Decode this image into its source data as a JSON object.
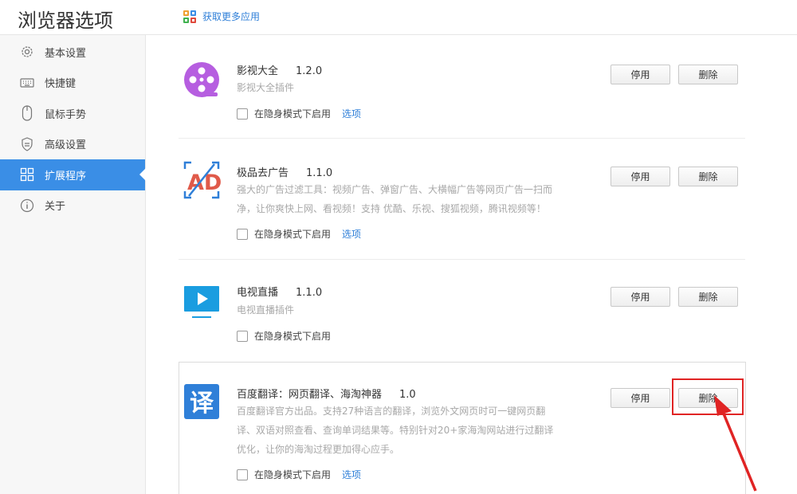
{
  "app": {
    "title": "浏览器选项"
  },
  "header": {
    "get_apps_label": "获取更多应用"
  },
  "sidebar": {
    "items": [
      {
        "label": "基本设置",
        "icon": "gear-icon"
      },
      {
        "label": "快捷键",
        "icon": "keyboard-icon"
      },
      {
        "label": "鼠标手势",
        "icon": "mouse-icon"
      },
      {
        "label": "高级设置",
        "icon": "shield-icon"
      },
      {
        "label": "扩展程序",
        "icon": "extensions-icon",
        "active": true
      },
      {
        "label": "关于",
        "icon": "info-icon"
      }
    ]
  },
  "extensions": [
    {
      "name": "影视大全",
      "version": "1.2.0",
      "description": [
        "影视大全插件"
      ],
      "incognito_label": "在隐身模式下启用",
      "options_label": "选项",
      "disable_label": "停用",
      "delete_label": "删除",
      "icon": "film-reel-icon"
    },
    {
      "name": "极品去广告",
      "version": "1.1.0",
      "description": [
        "强大的广告过滤工具：视频广告、弹窗广告、大横幅广告等网页广告一扫而",
        "净，让你爽快上网、看视频！支持 优酷、乐视、搜狐视频，腾讯视频等！"
      ],
      "incognito_label": "在隐身模式下启用",
      "options_label": "选项",
      "disable_label": "停用",
      "delete_label": "删除",
      "icon": "ad-block-icon"
    },
    {
      "name": "电视直播",
      "version": "1.1.0",
      "description": [
        "电视直播插件"
      ],
      "incognito_label": "在隐身模式下启用",
      "disable_label": "停用",
      "delete_label": "删除",
      "icon": "tv-play-icon"
    },
    {
      "name": "百度翻译：网页翻译、海淘神器",
      "version": "1.0",
      "description": [
        "百度翻译官方出品。支持27种语言的翻译，浏览外文网页时可一键网页翻",
        "译、双语对照查看、查询单词结果等。特别针对20+家海淘网站进行过翻译",
        "优化，让你的海淘过程更加得心应手。"
      ],
      "incognito_label": "在隐身模式下启用",
      "options_label": "选项",
      "disable_label": "停用",
      "delete_label": "删除",
      "icon": "translate-icon"
    }
  ],
  "colors": {
    "accent": "#3a8ee6",
    "link": "#2f7fd8",
    "highlight": "#e02424"
  }
}
